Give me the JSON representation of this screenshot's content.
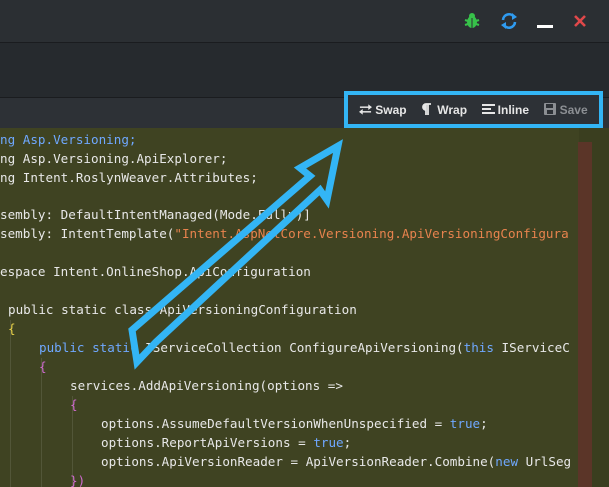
{
  "toolbar": {
    "swap_label": "Swap",
    "wrap_label": "Wrap",
    "inline_label": "Inline",
    "save_label": "Save"
  },
  "titlebar_icons": [
    "bug-icon",
    "refresh-icon",
    "minimize-icon",
    "close-icon"
  ],
  "colors": {
    "highlight_box": "#33b5f5",
    "bug_icon": "#37c24a",
    "refresh_icon": "#2f9bf0",
    "close_icon": "#e0484a",
    "editor_bg": "#3f4322"
  },
  "code": {
    "l1_a": "ng Asp.Versioning;",
    "l2_a": "ng Asp.Versioning.ApiExplorer;",
    "l3_a": "ng Intent.RoslynWeaver.Attributes;",
    "l5_a": "sembly: DefaultIntentManaged(Mode.Fully)]",
    "l6_a": "sembly: IntentTemplate(",
    "l6_b": "\"Intent.AspNetCore.Versioning.ApiVersioningConfigura",
    "l8_a": "espace Intent.OnlineShop.ApiConfiguration",
    "l10_a": "public static class ApiVersioningConfiguration",
    "l11_a": "{",
    "l12_kw": "public static",
    "l12_a": " IServiceCollection ConfigureApiVersioning(",
    "l12_kw2": "this",
    "l12_b": " IServiceC",
    "l13_a": "{",
    "l14_a": "services.AddApiVersioning(options =>",
    "l15_a": "{",
    "l16_a": "options.AssumeDefaultVersionWhenUnspecified = ",
    "l16_b": "true",
    "l16_c": ";",
    "l17_a": "options.ReportApiVersions = ",
    "l17_b": "true",
    "l17_c": ";",
    "l18_a": "options.ApiVersionReader = ApiVersionReader.Combine(",
    "l18_kw": "new",
    "l18_b": " UrlSeg",
    "l19_a": "})"
  }
}
